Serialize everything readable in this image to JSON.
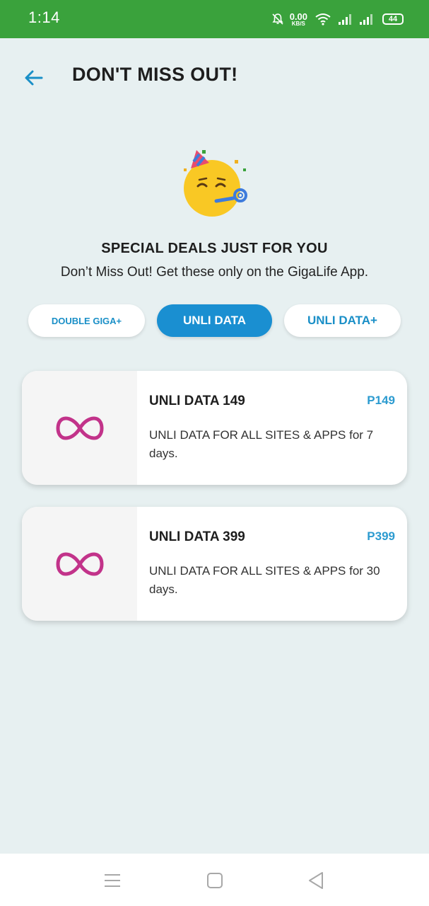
{
  "status_bar": {
    "time": "1:14",
    "net_speed_value": "0.00",
    "net_speed_unit": "KB/S",
    "battery": "44",
    "icons": [
      "mute-bell-icon",
      "wifi-icon",
      "signal-icon",
      "signal-icon",
      "battery-icon"
    ]
  },
  "header": {
    "title": "DON'T MISS OUT!",
    "back_icon": "back-arrow-icon"
  },
  "hero": {
    "emoji": "party-face-emoji",
    "title": "SPECIAL DEALS JUST FOR YOU",
    "subtitle": "Don’t Miss Out! Get these only on the GigaLife App."
  },
  "tabs": [
    {
      "label": "DOUBLE GIGA+",
      "active": false
    },
    {
      "label": "UNLI DATA",
      "active": true
    },
    {
      "label": "UNLI DATA+",
      "active": false
    }
  ],
  "offers": [
    {
      "name": "UNLI DATA 149",
      "price": "P149",
      "description": "UNLI DATA FOR ALL SITES & APPS for 7 days.",
      "icon": "infinity-icon"
    },
    {
      "name": "UNLI DATA 399",
      "price": "P399",
      "description": "UNLI DATA FOR ALL SITES & APPS for 30 days.",
      "icon": "infinity-icon"
    }
  ],
  "colors": {
    "status_bar": "#3aa23c",
    "background": "#e7f0f1",
    "accent": "#1a8fd1",
    "price": "#2c9bd0",
    "infinity": "#c2338a"
  },
  "nav_bar": [
    "menu-icon",
    "home-icon",
    "back-icon"
  ]
}
